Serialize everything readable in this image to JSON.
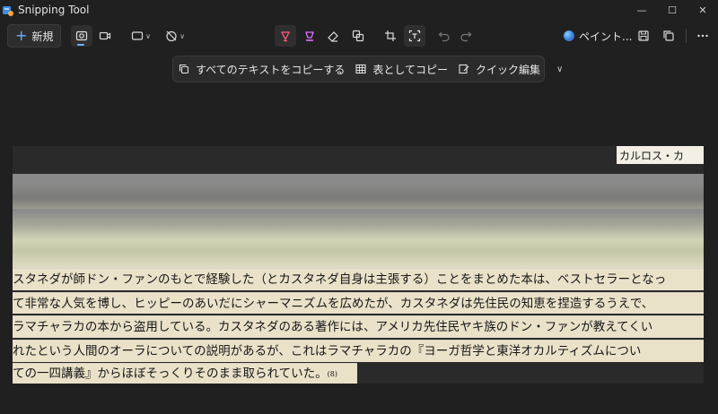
{
  "window": {
    "title": "Snipping Tool",
    "controls": {
      "minimize": "—",
      "maximize": "☐",
      "close": "✕"
    }
  },
  "toolbar": {
    "new_label": "新規",
    "paint_label": "ペイント..."
  },
  "text_actions": {
    "copy_all_text": "すべてのテキストをコピーする",
    "copy_as_table": "表としてコピー",
    "quick_edit": "クイック編集"
  },
  "screenshot": {
    "corner_label": "カルロス・カ",
    "lines": [
      "スタネダが師ドン・ファンのもとで経験した（とカスタネダ自身は主張する）ことをまとめた本は、ベストセラーとなっ",
      "て非常な人気を博し、ヒッピーのあいだにシャーマニズムを広めたが、カスタネダは先住民の知恵を捏造するうえで、",
      "ラマチャラカの本から盗用している。カスタネダのある著作には、アメリカ先住民ヤキ族のドン・ファンが教えてくい",
      "れたという人間のオーラについての説明があるが、これはラマチャラカの『ヨーガ哲学と東洋オカルティズムについ",
      "ての一四講義』からほぼそっくりそのまま取られていた。"
    ],
    "footnote": "(8)"
  }
}
